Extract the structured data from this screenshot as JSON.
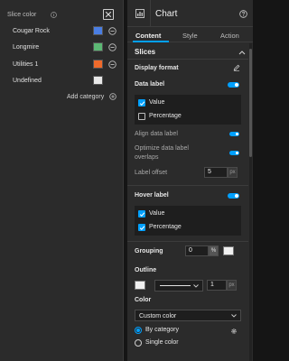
{
  "popup": {
    "title": "Slice color",
    "slices": [
      {
        "label": "Cougar Rock",
        "color": "#4a7ee3"
      },
      {
        "label": "Longmire",
        "color": "#5cb874"
      },
      {
        "label": "Utilities 1",
        "color": "#ef6a2b"
      },
      {
        "label": "Undefined",
        "color": "#e8e8e8"
      }
    ],
    "add_category_label": "Add category"
  },
  "panel": {
    "title": "Chart",
    "tabs": [
      "Content",
      "Style",
      "Action"
    ],
    "active_tab": "Content",
    "slices_section": "Slices",
    "display_format": "Display format",
    "data_label": {
      "label": "Data label",
      "enabled": true,
      "value_label": "Value",
      "value_checked": true,
      "percentage_label": "Percentage",
      "percentage_checked": false
    },
    "align_data_label": "Align data label",
    "optimize_label": "Optimize data label overlaps",
    "optimize_line1": "Optimize data label",
    "optimize_line2": "overlaps",
    "label_offset": {
      "label": "Label offset",
      "value": "5",
      "unit": "px"
    },
    "hover_label": {
      "label": "Hover label",
      "enabled": true,
      "value_label": "Value",
      "value_checked": true,
      "percentage_label": "Percentage",
      "percentage_checked": true
    },
    "grouping": {
      "label": "Grouping",
      "value": "0",
      "unit": "%"
    },
    "outline": {
      "label": "Outline",
      "width": "1",
      "unit": "px"
    },
    "color": {
      "label": "Color",
      "dropdown": "Custom color",
      "options": [
        "By category",
        "Single color"
      ],
      "selected": "By category"
    }
  },
  "colors": {
    "accent": "#00a0ff",
    "background": "#2b2b2b"
  }
}
